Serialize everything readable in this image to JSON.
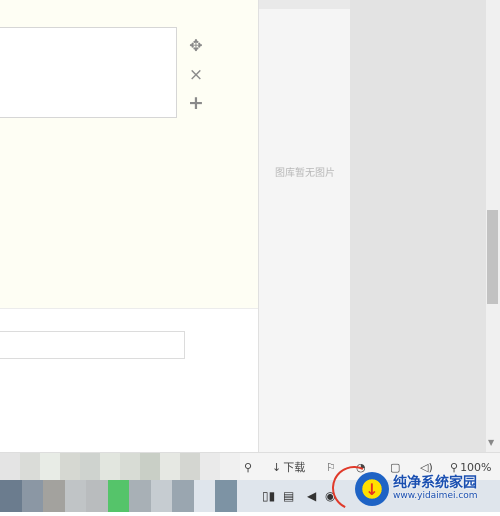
{
  "editor": {
    "tools": [
      {
        "icon": "move-icon",
        "glyph": "✥"
      },
      {
        "icon": "close-icon",
        "glyph": "×"
      },
      {
        "icon": "add-icon",
        "glyph": "+"
      }
    ]
  },
  "gallery": {
    "empty_text": "图库暂无图片"
  },
  "status_bar": {
    "download_label": "下载",
    "zoom": "100%"
  },
  "watermark": {
    "title": "纯净系统家园",
    "url": "www.yidaimei.com"
  },
  "colors": {
    "cream_bg": "#fefef4",
    "gallery_bg": "#f5f5f5",
    "pane_bg": "#e3e3e3",
    "accent_red": "#e03a2a"
  }
}
